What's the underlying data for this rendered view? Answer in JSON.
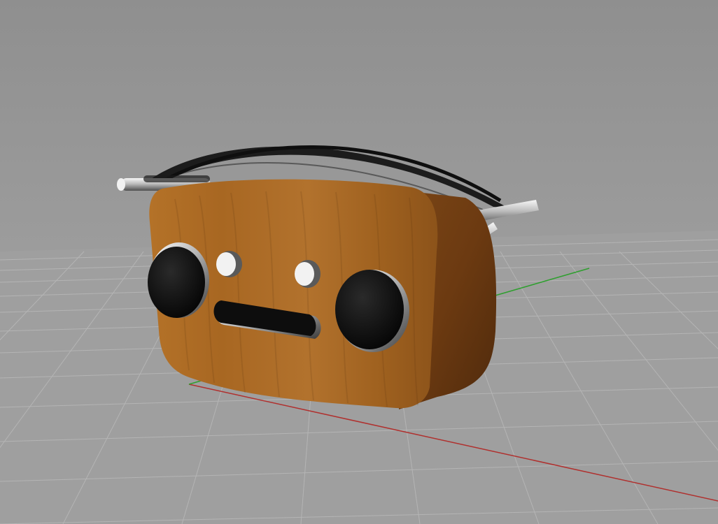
{
  "viewport": {
    "background": "#9e9e9e",
    "grid_color": "#b8b8b8",
    "axis_x_color": "#b0302e",
    "axis_y_color": "#2e9f2e"
  },
  "model": {
    "body_color": "#a86a26",
    "body_side_color": "#6a3d10",
    "handle_color": "#1b1b1b",
    "metal_color": "#d9d9d9",
    "speaker_color": "#101010"
  }
}
